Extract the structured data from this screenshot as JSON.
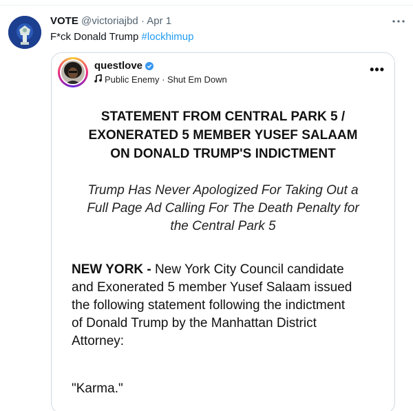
{
  "tweet": {
    "display_name": "VOTE",
    "handle": "@victoriajbd",
    "separator": "·",
    "time": "Apr 1",
    "more_icon": "more-horizontal-icon",
    "text": "F*ck Donald Trump ",
    "hashtag": "#lockhimup",
    "hashtag_color": "#1d9bf0"
  },
  "quoted_post": {
    "username": "questlove",
    "verified_icon": "verified-badge-icon",
    "verified_color": "#3897f0",
    "music_icon": "music-note-icon",
    "song": "Public Enemy · Shut Em Down",
    "more_icon": "more-horizontal-icon",
    "more_label": "•••"
  },
  "statement": {
    "title_lines": [
      "STATEMENT FROM CENTRAL PARK 5 /",
      "EXONERATED 5 MEMBER YUSEF SALAAM",
      "ON DONALD TRUMP'S INDICTMENT"
    ],
    "subtitle_lines": [
      "Trump Has Never Apologized For Taking Out a",
      "Full Page Ad Calling For The Death Penalty for",
      "the Central Park 5"
    ],
    "dateline": "NEW YORK -",
    "body_lines": [
      " New York City Council candidate",
      "and Exonerated 5 member Yusef Salaam issued",
      "the following statement following the indictment",
      "of Donald Trump by the Manhattan District",
      "Attorney:"
    ],
    "quote": "\"Karma.\""
  }
}
